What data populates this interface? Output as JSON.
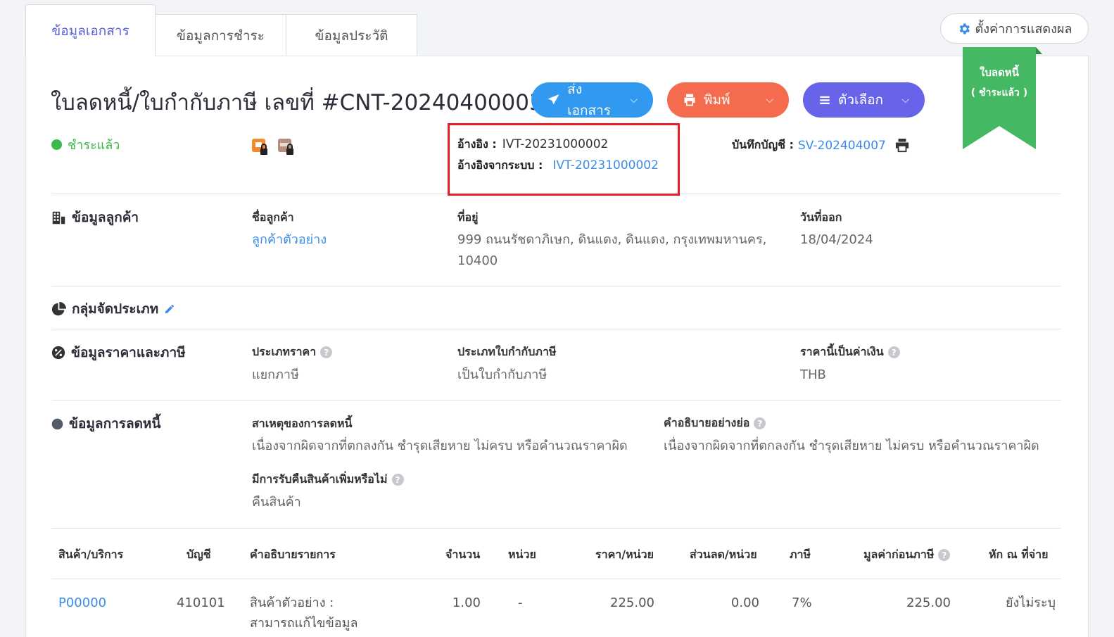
{
  "tabs": [
    {
      "label": "ข้อมูลเอกสาร",
      "active": true
    },
    {
      "label": "ข้อมูลการชำระ",
      "active": false
    },
    {
      "label": "ข้อมูลประวัติ",
      "active": false
    }
  ],
  "settings_button": {
    "label": "ตั้งค่าการแสดงผล",
    "icon": "gear-icon"
  },
  "ribbon": {
    "line1": "ใบลดหนี้",
    "line2": "( ชำระแล้ว )",
    "color": "#45b864"
  },
  "header": {
    "title": "ใบลดหนี้/ใบกำกับภาษี เลขที่ #CNT-20240400003",
    "buttons": {
      "send": "ส่งเอกสาร",
      "print": "พิมพ์",
      "options": "ตัวเลือก"
    }
  },
  "status": {
    "label": "ชำระแล้ว",
    "color": "#3cb84c"
  },
  "reference": {
    "ref_label": "อ้างอิง :",
    "ref_value": "IVT-20231000002",
    "system_ref_label": "อ้างอิงจากระบบ :",
    "system_ref_value": "IVT-20231000002"
  },
  "accounting": {
    "label": "บันทึกบัญชี :",
    "value": "SV-202404007"
  },
  "customer_section": {
    "title": "ข้อมูลลูกค้า",
    "name_label": "ชื่อลูกค้า",
    "name_value": "ลูกค้าตัวอย่าง",
    "address_label": "ที่อยู่",
    "address_line1": "999 ถนนรัชดาภิเษก, ดินแดง, ดินแดง, กรุงเทพมหานคร,",
    "address_line2": "10400",
    "date_label": "วันที่ออก",
    "date_value": "18/04/2024"
  },
  "category_section": {
    "title": "กลุ่มจัดประเภท"
  },
  "price_section": {
    "title": "ข้อมูลราคาและภาษี",
    "price_type_label": "ประเภทราคา",
    "price_type_value": "แยกภาษี",
    "tax_invoice_type_label": "ประเภทใบกำกับภาษี",
    "tax_invoice_type_value": "เป็นใบกำกับภาษี",
    "currency_label": "ราคานี้เป็นค่าเงิน",
    "currency_value": "THB"
  },
  "credit_section": {
    "title": "ข้อมูลการลดหนี้",
    "reason_label": "สาเหตุของการลดหนี้",
    "reason_value": "เนื่องจากผิดจากที่ตกลงกัน ชำรุดเสียหาย ไม่ครบ หรือคำนวณราคาผิด",
    "short_desc_label": "คำอธิบายอย่างย่อ",
    "short_desc_value": "เนื่องจากผิดจากที่ตกลงกัน ชำรุดเสียหาย ไม่ครบ หรือคำนวณราคาผิด",
    "return_label": "มีการรับคืนสินค้าเพิ่มหรือไม่",
    "return_value": "คืนสินค้า"
  },
  "table": {
    "headers": {
      "product": "สินค้า/บริการ",
      "account": "บัญชี",
      "description": "คำอธิบายรายการ",
      "quantity": "จำนวน",
      "unit": "หน่วย",
      "price": "ราคา/หน่วย",
      "discount": "ส่วนลด/หน่วย",
      "tax": "ภาษี",
      "pretax": "มูลค่าก่อนภาษี",
      "withholding": "หัก ณ ที่จ่าย"
    },
    "rows": [
      {
        "product": "P00000",
        "account": "410101",
        "description_line1": "สินค้าตัวอย่าง :",
        "description_line2": "สามารถแก้ไขข้อมูล",
        "quantity": "1.00",
        "unit": "-",
        "price": "225.00",
        "discount": "0.00",
        "tax": "7%",
        "pretax": "225.00",
        "withholding": "ยังไม่ระบุ"
      }
    ]
  }
}
